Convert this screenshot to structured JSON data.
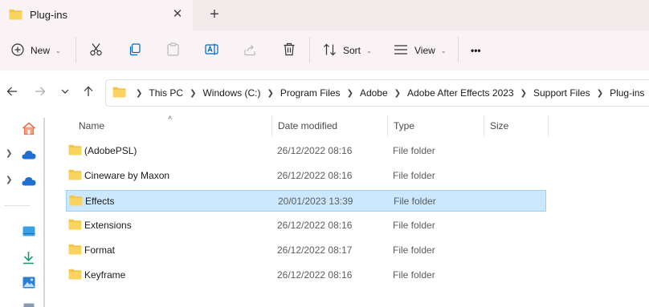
{
  "tab": {
    "title": "Plug-ins",
    "close": "✕",
    "new_tab": "+"
  },
  "toolbar": {
    "new_label": "New",
    "sort_label": "Sort",
    "view_label": "View",
    "more": "•••"
  },
  "address": {
    "crumbs": [
      "This PC",
      "Windows (C:)",
      "Program Files",
      "Adobe",
      "Adobe After Effects 2023",
      "Support Files",
      "Plug-ins"
    ]
  },
  "columns": {
    "name": "Name",
    "date": "Date modified",
    "type": "Type",
    "size": "Size"
  },
  "files": [
    {
      "name": "(AdobePSL)",
      "date": "26/12/2022 08:16",
      "type": "File folder",
      "selected": false
    },
    {
      "name": "Cineware by Maxon",
      "date": "26/12/2022 08:16",
      "type": "File folder",
      "selected": false
    },
    {
      "name": "Effects",
      "date": "20/01/2023 13:39",
      "type": "File folder",
      "selected": true
    },
    {
      "name": "Extensions",
      "date": "26/12/2022 08:16",
      "type": "File folder",
      "selected": false
    },
    {
      "name": "Format",
      "date": "26/12/2022 08:17",
      "type": "File folder",
      "selected": false
    },
    {
      "name": "Keyframe",
      "date": "26/12/2022 08:16",
      "type": "File folder",
      "selected": false
    }
  ],
  "colors": {
    "accent": "#0067c0",
    "selection": "#cce8ff",
    "folder": "#f4c542"
  }
}
